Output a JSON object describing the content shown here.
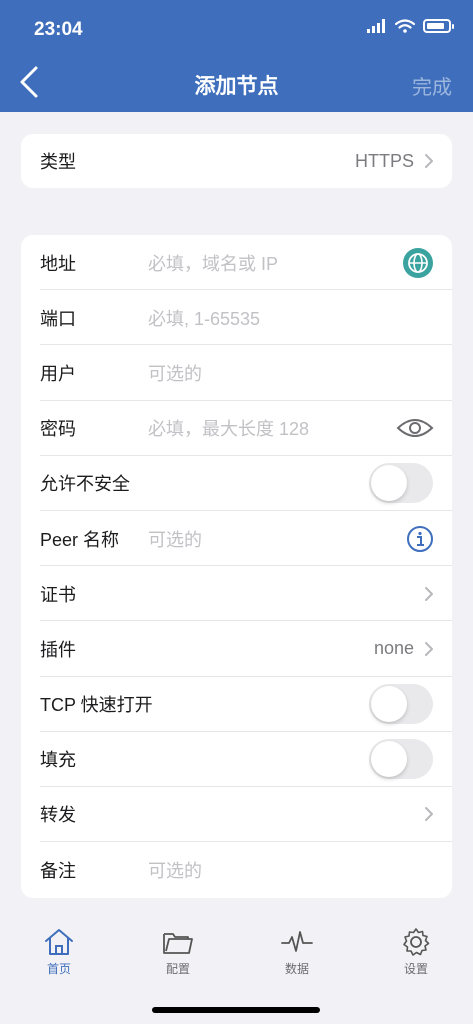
{
  "status": {
    "time": "23:04"
  },
  "nav": {
    "title": "添加节点",
    "done": "完成"
  },
  "type_row": {
    "label": "类型",
    "value": "HTTPS"
  },
  "form": {
    "address": {
      "label": "地址",
      "placeholder": "必填，域名或 IP",
      "icon": "globe-icon"
    },
    "port": {
      "label": "端口",
      "placeholder": "必填, 1-65535"
    },
    "user": {
      "label": "用户",
      "placeholder": "可选的"
    },
    "password": {
      "label": "密码",
      "placeholder": "必填，最大长度 128",
      "icon": "eye-icon"
    },
    "allow_insecure": {
      "label": "允许不安全",
      "on": false
    },
    "peer_name": {
      "label": "Peer 名称",
      "placeholder": "可选的",
      "icon": "info-icon"
    },
    "certificate": {
      "label": "证书"
    },
    "plugin": {
      "label": "插件",
      "value": "none"
    },
    "tcp_fast_open": {
      "label": "TCP 快速打开",
      "on": false
    },
    "padding": {
      "label": "填充",
      "on": false
    },
    "forward": {
      "label": "转发"
    },
    "note": {
      "label": "备注",
      "placeholder": "可选的"
    }
  },
  "tabbar": {
    "tabs": [
      {
        "label": "首页",
        "icon": "home-icon",
        "active": true
      },
      {
        "label": "配置",
        "icon": "folder-icon",
        "active": false
      },
      {
        "label": "数据",
        "icon": "activity-icon",
        "active": false
      },
      {
        "label": "设置",
        "icon": "gear-icon",
        "active": false
      }
    ]
  },
  "colors": {
    "accent": "#3f6fbc",
    "globe": "#3aa3a0"
  }
}
